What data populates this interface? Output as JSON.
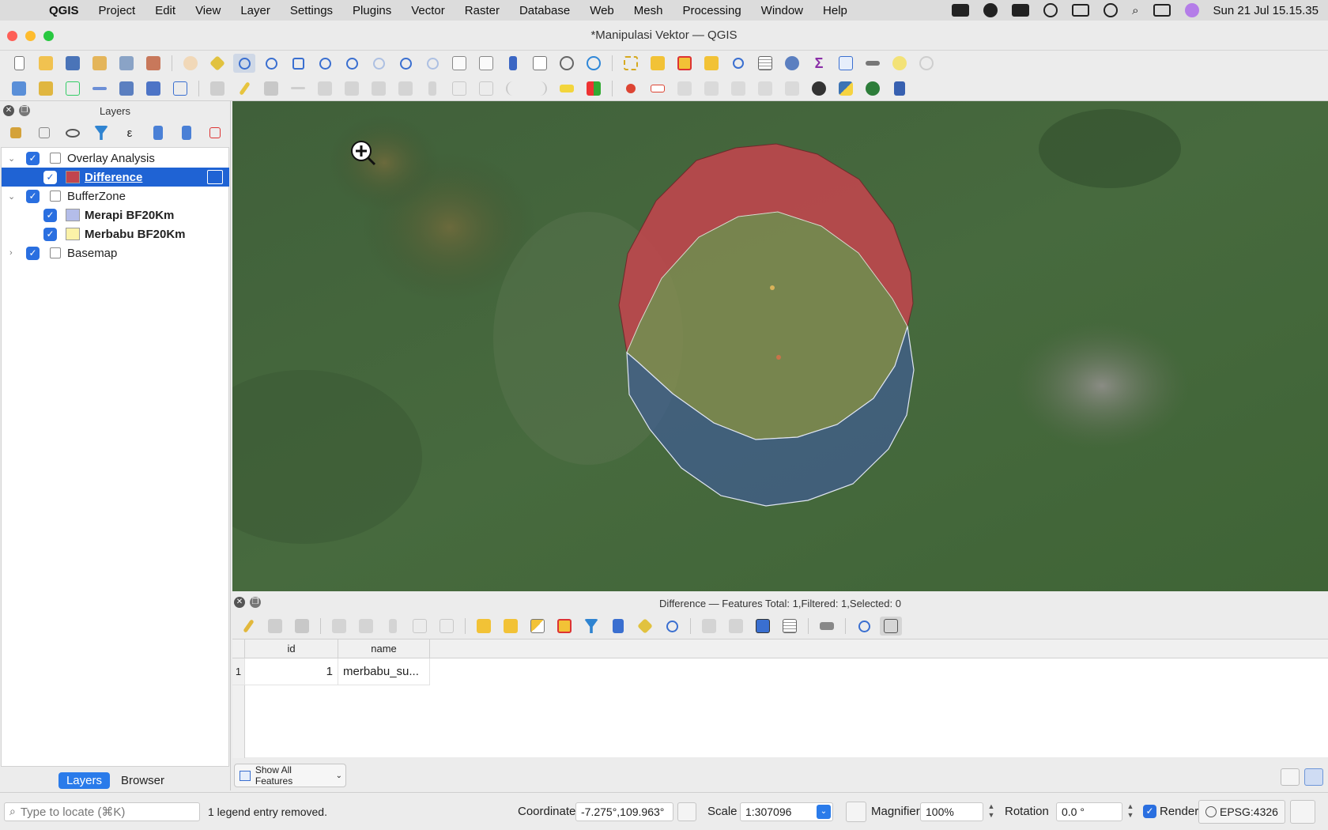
{
  "menubar": {
    "app": "QGIS",
    "items": [
      "Project",
      "Edit",
      "View",
      "Layer",
      "Settings",
      "Plugins",
      "Vector",
      "Raster",
      "Database",
      "Web",
      "Mesh",
      "Processing",
      "Window",
      "Help"
    ],
    "datetime": "Sun 21 Jul  15.15.35"
  },
  "window": {
    "title": "*Manipulasi Vektor — QGIS"
  },
  "layers_panel": {
    "title": "Layers",
    "tree": [
      {
        "label": "Overlay Analysis",
        "type": "group",
        "checked": true
      },
      {
        "label": "Difference",
        "type": "layer",
        "checked": true,
        "color": "#c1454d",
        "selected": true
      },
      {
        "label": "BufferZone",
        "type": "group",
        "checked": true
      },
      {
        "label": "Merapi BF20Km",
        "type": "layer",
        "checked": true,
        "color": "#b4bde9"
      },
      {
        "label": "Merbabu BF20Km",
        "type": "layer",
        "checked": true,
        "color": "#fbf2a8"
      },
      {
        "label": "Basemap",
        "type": "group",
        "checked": true
      }
    ],
    "tabs": [
      "Layers",
      "Browser"
    ],
    "active_tab": "Layers"
  },
  "map": {
    "difference_color": "#c1454d",
    "merapi_color": "#3f5aa0",
    "overlap_color": "#8a9054"
  },
  "attribute_table": {
    "title": "Difference — Features Total: 1,Filtered: 1,Selected: 0",
    "columns": [
      "id",
      "name"
    ],
    "rows": [
      {
        "row_num": "1",
        "id": "1",
        "name": "merbabu_su..."
      }
    ],
    "show_all_label": "Show All Features"
  },
  "status": {
    "locate_placeholder": "Type to locate (⌘K)",
    "message": "1 legend entry removed.",
    "coordinate_label": "Coordinate",
    "coordinate": "-7.275°,109.963°",
    "scale_label": "Scale",
    "scale": "1:307096",
    "magnifier_label": "Magnifier",
    "magnifier": "100%",
    "rotation_label": "Rotation",
    "rotation": "0.0 °",
    "render_label": "Render",
    "crs": "EPSG:4326"
  }
}
